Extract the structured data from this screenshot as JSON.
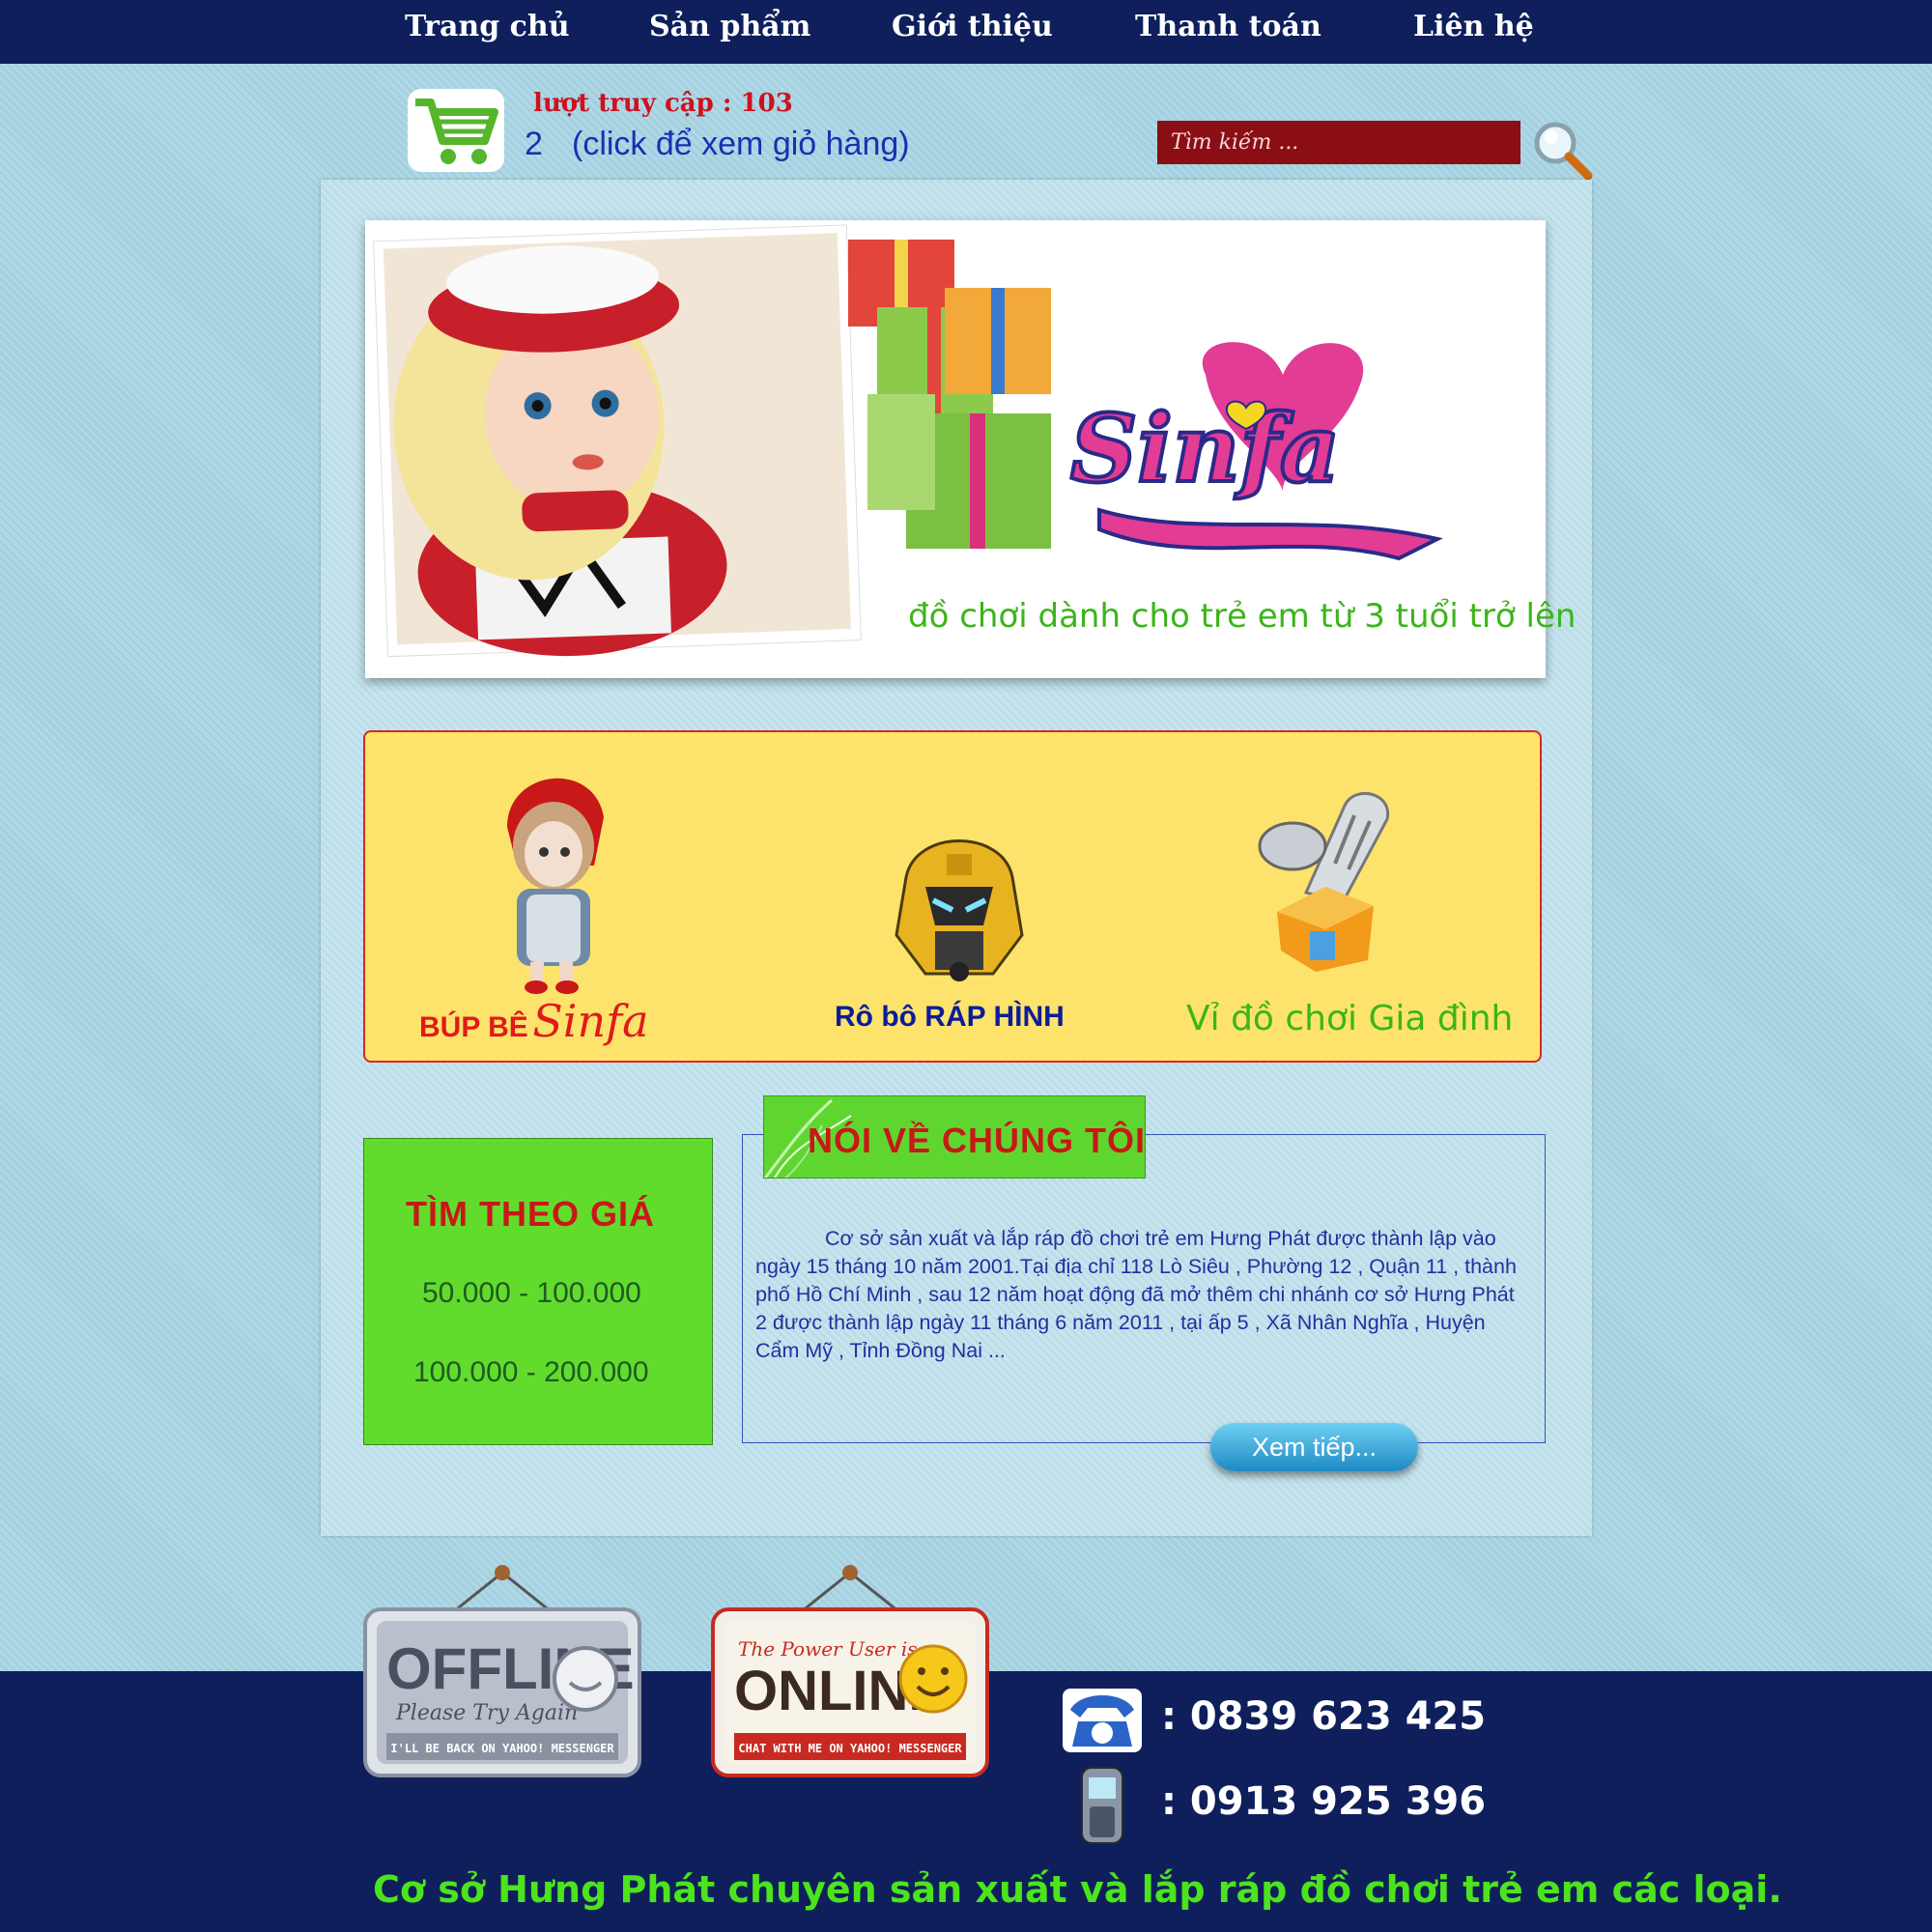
{
  "nav": {
    "items": [
      {
        "label": "Trang chủ"
      },
      {
        "label": "Sản phẩm"
      },
      {
        "label": "Giới thiệu"
      },
      {
        "label": "Thanh toán"
      },
      {
        "label": "Liên hệ"
      }
    ]
  },
  "header": {
    "visits": "lượt truy cập : 103",
    "cart_count": "2",
    "cart_link": "(click để xem giỏ hàng)",
    "search_placeholder": "Tìm kiếm ..."
  },
  "banner": {
    "logo": "Sinfa",
    "tagline": "đồ chơi dành cho trẻ em từ 3 tuổi trở lên"
  },
  "categories": [
    {
      "label": "BÚP BÊ",
      "brand": "Sinfa"
    },
    {
      "label": "Rô bô RÁP HÌNH"
    },
    {
      "label": "Vỉ đồ chơi Gia đình"
    }
  ],
  "price_filter": {
    "title": "TÌM THEO GIÁ",
    "ranges": [
      "50.000 - 100.000",
      "100.000 - 200.000"
    ]
  },
  "about": {
    "title": "NÓI VỀ CHÚNG TÔI",
    "text": "Cơ sở sản xuất và lắp ráp đồ chơi trẻ em Hưng Phát được thành lập vào ngày 15 tháng 10 năm 2001.Tại địa chỉ 118 Lò Siêu , Phường 12 , Quận 11 , thành phố Hồ Chí Minh , sau 12 năm hoạt động đã mở thêm chi nhánh cơ sở Hưng Phát 2 được thành  lập ngày 11 tháng 6 năm 2011 , tại ấp 5 , Xã Nhân Nghĩa , Huyện Cẩm Mỹ , Tỉnh Đồng Nai ...",
    "more_button": "Xem tiếp..."
  },
  "footer": {
    "offline_sign": {
      "big": "OFFLINE",
      "script": "Please Try Again",
      "small": "I'LL BE BACK ON YAHOO! MESSENGER"
    },
    "online_sign": {
      "script": "The Power User is",
      "big": "ONLINE",
      "small": "CHAT WITH ME ON YAHOO! MESSENGER"
    },
    "phone1": ":  0839 623 425",
    "phone2": ":  0913 925 396",
    "slogan": "Cơ sở Hưng Phát chuyên sản xuất và lắp ráp đồ chơi trẻ em các loại."
  }
}
